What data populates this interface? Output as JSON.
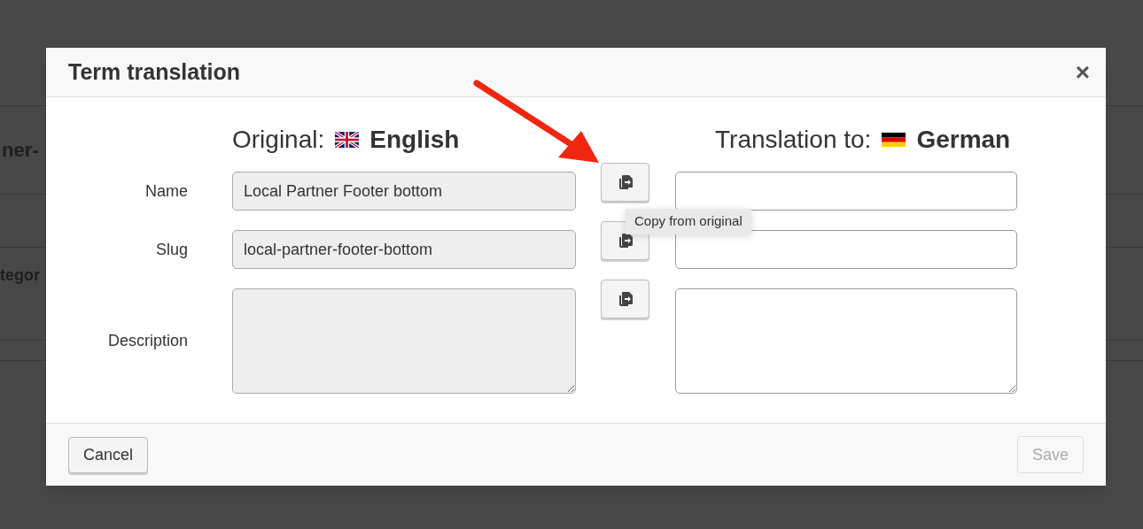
{
  "background": {
    "fragments": [
      "ner-",
      "tegor"
    ]
  },
  "dialog": {
    "title": "Term translation",
    "close": "×",
    "original": {
      "label": "Original:",
      "language": "English"
    },
    "translation": {
      "label": "Translation to:",
      "language": "German"
    },
    "rows": [
      {
        "kind": "input",
        "label": "Name",
        "original_value": "Local Partner Footer bottom"
      },
      {
        "kind": "input",
        "label": "Slug",
        "original_value": "local-partner-footer-bottom"
      },
      {
        "kind": "textarea",
        "label": "Description"
      }
    ],
    "tooltip": "Copy from original",
    "buttons": {
      "cancel": {
        "label": "Cancel"
      },
      "save": {
        "label": "Save",
        "disabled": true
      }
    }
  }
}
